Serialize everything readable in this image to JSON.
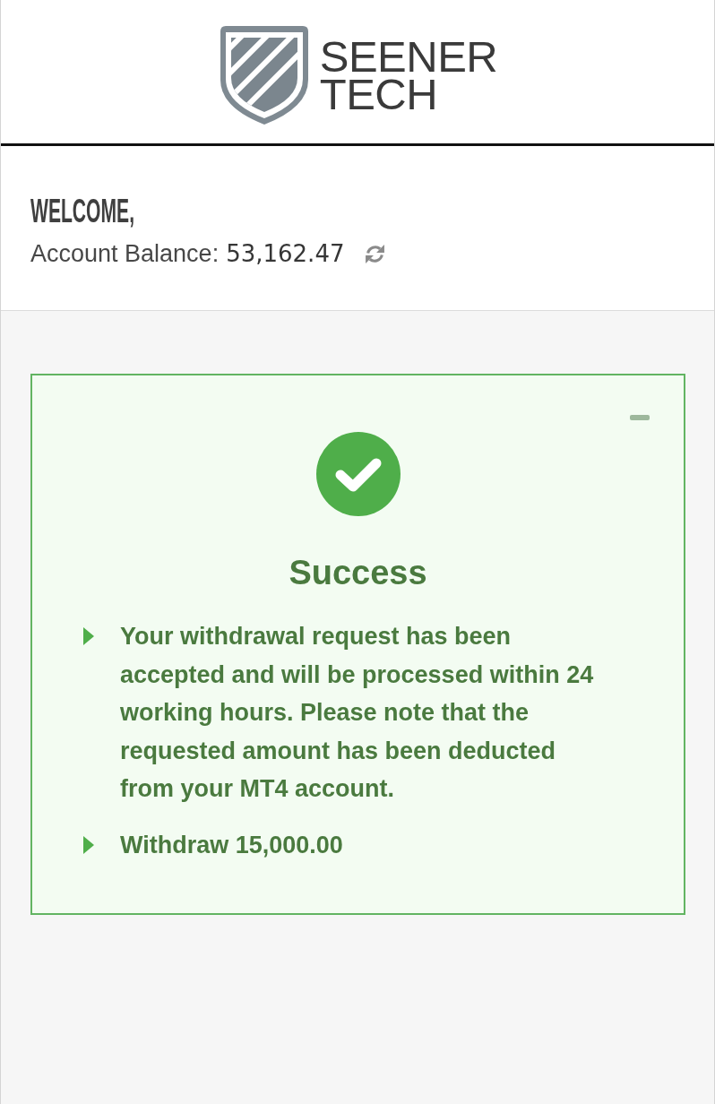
{
  "header": {
    "logo": {
      "line_1": "SEENER",
      "line_2": "TECH"
    }
  },
  "welcome": {
    "greeting": "WELCOME,",
    "balance_label": "Account Balance:",
    "balance_value": "53,162.47"
  },
  "alert": {
    "kind": "success",
    "title": "Success",
    "items": [
      "Your withdrawal request has been accepted and will be processed within 24 working hours. Please note that the requested amount has been deducted from your MT4 account.",
      "Withdraw 15,000.00"
    ]
  }
}
